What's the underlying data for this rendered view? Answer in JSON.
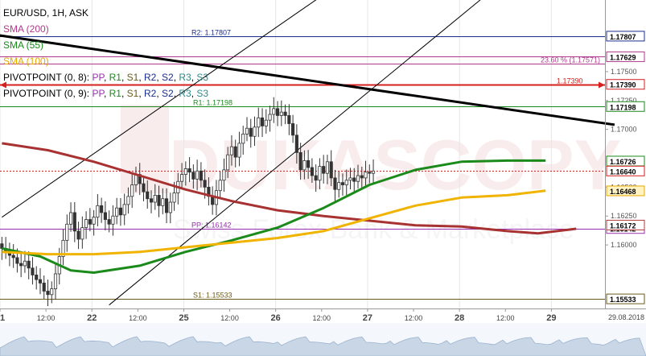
{
  "legend": {
    "symbol_line": "EUR/USD, 1H, ASK",
    "indicators": [
      {
        "label": "SMA (200)",
        "color": "#b03a8a"
      },
      {
        "label": "SMA (55)",
        "color": "#1a8a1a"
      },
      {
        "label": "SMA (100)",
        "color": "#e8a800"
      }
    ],
    "pivot_lines": [
      {
        "prefix": "PIVOTPOINT (0, 8): ",
        "parts": [
          "PP",
          "R1",
          "S1",
          "R2",
          "S2",
          "R3",
          "S3"
        ]
      },
      {
        "prefix": "PIVOTPOINT (0, 9): ",
        "parts": [
          "PP",
          "R1",
          "S1",
          "R2",
          "S2",
          "R3",
          "S3"
        ]
      }
    ],
    "pivot_colors": {
      "PP": "#9a2fb0",
      "R1": "#1a8a1a",
      "S1": "#6b5a1a",
      "R2": "#1a2d8a",
      "S2": "#1a2d8a",
      "R3": "#2f8a8a",
      "S3": "#2f8a8a"
    }
  },
  "watermark": {
    "brand": "DUKASCOPY",
    "tagline": "Swiss Forex Bank & Marketplace"
  },
  "chart_data": {
    "type": "candlestick",
    "symbol": "EUR/USD",
    "timeframe": "1H",
    "price_side": "ASK",
    "ylim": [
      1.1545,
      1.1812
    ],
    "y_ticks": [
      1.16,
      1.1625,
      1.165,
      1.17,
      1.1725,
      1.175
    ],
    "y_tick_labels": [
      "1.16000",
      "1.16250",
      "1.16500",
      "1.17000",
      "1.17250",
      "1.17500"
    ],
    "x_tick_labels": [
      "21",
      "12:00",
      "22",
      "12:00",
      "25",
      "12:00",
      "26",
      "12:00",
      "27",
      "12:00",
      "28",
      "12:00",
      "29"
    ],
    "x_date_label": "29.08.2018",
    "horizontal_levels": [
      {
        "label": "R2: 1.17807",
        "value": 1.17807,
        "color": "#1a2d8a",
        "tag": "1.17807"
      },
      {
        "label": "23.60 % (1.17571)",
        "value": 1.17571,
        "color": "#b03a8a",
        "tag": ""
      },
      {
        "label": "",
        "value": 1.17629,
        "color": "#b03a8a",
        "tag": "1.17629"
      },
      {
        "label": "1.17390",
        "value": 1.1739,
        "color": "#d62020",
        "tag": "1.17390"
      },
      {
        "label": "R1: 1.17198",
        "value": 1.17198,
        "color": "#1a8a1a",
        "tag": "1.17198"
      },
      {
        "label": "PP: 1.16142",
        "value": 1.16142,
        "color": "#9a2fb0",
        "tag": "1.16142"
      },
      {
        "label": "S1: 1.15533",
        "value": 1.15533,
        "color": "#6b5a1a",
        "tag": "1.15533"
      }
    ],
    "price_tags": [
      {
        "value": 1.16726,
        "text": "1.16726",
        "color": "#1a8a1a"
      },
      {
        "value": 1.1664,
        "text": "1.16640",
        "color": "#d62020"
      },
      {
        "value": 1.16468,
        "text": "1.16468",
        "color": "#e8a800"
      },
      {
        "value": 1.16172,
        "text": "1.16172",
        "color": "#b03a3a"
      }
    ],
    "current_price": 1.1664,
    "candles": {
      "start_index": 0,
      "close": [
        1.1597,
        1.1595,
        1.1591,
        1.1589,
        1.1584,
        1.1582,
        1.1586,
        1.158,
        1.1574,
        1.157,
        1.1567,
        1.156,
        1.1557,
        1.1562,
        1.1575,
        1.159,
        1.1604,
        1.1618,
        1.1628,
        1.1612,
        1.1605,
        1.1615,
        1.1622,
        1.1618,
        1.1624,
        1.1634,
        1.1628,
        1.1622,
        1.1618,
        1.1625,
        1.1632,
        1.1626,
        1.1635,
        1.1642,
        1.1652,
        1.1661,
        1.1653,
        1.1646,
        1.164,
        1.1637,
        1.1643,
        1.1634,
        1.164,
        1.1628,
        1.1637,
        1.1645,
        1.1655,
        1.1661,
        1.1666,
        1.1663,
        1.1657,
        1.1664,
        1.1656,
        1.165,
        1.1642,
        1.1635,
        1.1647,
        1.1656,
        1.1665,
        1.1678,
        1.1685,
        1.1676,
        1.1688,
        1.1696,
        1.1701,
        1.1694,
        1.1702,
        1.171,
        1.1703,
        1.1708,
        1.1713,
        1.1718,
        1.1712,
        1.1715,
        1.1712,
        1.1705,
        1.1695,
        1.168,
        1.1665,
        1.1673,
        1.1667,
        1.166,
        1.1656,
        1.1668,
        1.1662,
        1.1672,
        1.1658,
        1.1648,
        1.1654,
        1.1652,
        1.1656,
        1.1658,
        1.1655,
        1.166,
        1.1658,
        1.1663,
        1.1662,
        1.1664
      ],
      "open_close_wick": "ohlc values reconstructed from a close series"
    },
    "series": [
      {
        "name": "SMA (200)",
        "color": "#a83232",
        "values": [
          [
            0,
            1.1688
          ],
          [
            12,
            1.1682
          ],
          [
            24,
            1.1672
          ],
          [
            36,
            1.166
          ],
          [
            48,
            1.1648
          ],
          [
            60,
            1.1638
          ],
          [
            72,
            1.163
          ],
          [
            84,
            1.1625
          ],
          [
            96,
            1.1621
          ],
          [
            108,
            1.1617
          ],
          [
            120,
            1.1616
          ],
          [
            132,
            1.1612
          ],
          [
            140,
            1.161
          ],
          [
            150,
            1.1614
          ]
        ]
      },
      {
        "name": "SMA (55)",
        "color": "#1a8a1a",
        "values": [
          [
            0,
            1.1597
          ],
          [
            10,
            1.159
          ],
          [
            18,
            1.1578
          ],
          [
            24,
            1.1576
          ],
          [
            36,
            1.1582
          ],
          [
            48,
            1.1594
          ],
          [
            60,
            1.1604
          ],
          [
            72,
            1.1615
          ],
          [
            84,
            1.1632
          ],
          [
            96,
            1.1652
          ],
          [
            108,
            1.1665
          ],
          [
            120,
            1.1672
          ],
          [
            132,
            1.1673
          ],
          [
            142,
            1.1673
          ]
        ]
      },
      {
        "name": "SMA (100)",
        "color": "#f0b400",
        "values": [
          [
            0,
            1.1594
          ],
          [
            12,
            1.1592
          ],
          [
            24,
            1.1592
          ],
          [
            36,
            1.1594
          ],
          [
            48,
            1.1598
          ],
          [
            60,
            1.1602
          ],
          [
            72,
            1.1606
          ],
          [
            84,
            1.1612
          ],
          [
            96,
            1.1623
          ],
          [
            108,
            1.1634
          ],
          [
            120,
            1.1641
          ],
          [
            132,
            1.1643
          ],
          [
            142,
            1.1647
          ]
        ]
      }
    ],
    "trendlines": [
      {
        "name": "resistance",
        "from": [
          -2,
          1.1782
        ],
        "to": [
          160,
          1.1704
        ],
        "color": "#000000",
        "width": 3
      },
      {
        "name": "channel-upper",
        "from": [
          0,
          1.1624
        ],
        "to": [
          92,
          1.1835
        ],
        "color": "#000000",
        "width": 1
      },
      {
        "name": "channel-lower",
        "from": [
          28,
          1.1548
        ],
        "to": [
          126,
          1.1815
        ],
        "color": "#000000",
        "width": 1
      }
    ]
  }
}
